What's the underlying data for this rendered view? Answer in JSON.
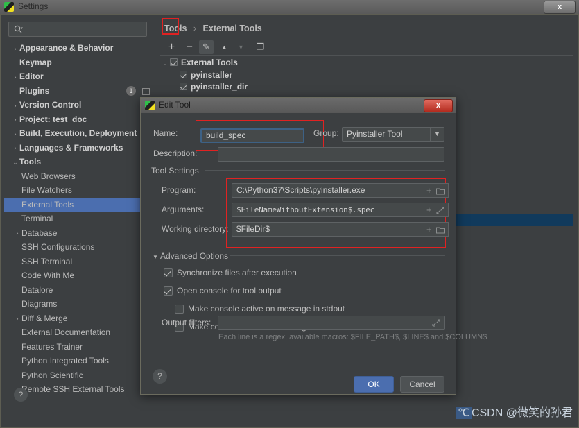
{
  "window": {
    "title": "Settings",
    "close_label": "x",
    "icon": "pycharm-icon"
  },
  "sidebar": {
    "search": {
      "value": "",
      "placeholder": ""
    },
    "items": [
      {
        "label": "Appearance & Behavior",
        "level": 0,
        "arrow": "›",
        "selected": false,
        "badge": "",
        "mini": ""
      },
      {
        "label": "Keymap",
        "level": 0,
        "arrow": "",
        "selected": false,
        "badge": "",
        "mini": ""
      },
      {
        "label": "Editor",
        "level": 0,
        "arrow": "›",
        "selected": false,
        "badge": "",
        "mini": ""
      },
      {
        "label": "Plugins",
        "level": 0,
        "arrow": "",
        "selected": false,
        "badge": "1",
        "mini": "outline"
      },
      {
        "label": "Version Control",
        "level": 0,
        "arrow": "›",
        "selected": false,
        "badge": "",
        "mini": "outline"
      },
      {
        "label": "Project: test_doc",
        "level": 0,
        "arrow": "›",
        "selected": false,
        "badge": "",
        "mini": "outline"
      },
      {
        "label": "Build, Execution, Deployment",
        "level": 0,
        "arrow": "›",
        "selected": false,
        "badge": "",
        "mini": ""
      },
      {
        "label": "Languages & Frameworks",
        "level": 0,
        "arrow": "›",
        "selected": false,
        "badge": "",
        "mini": ""
      },
      {
        "label": "Tools",
        "level": 0,
        "arrow": "⌄",
        "selected": false,
        "badge": "",
        "mini": ""
      },
      {
        "label": "Web Browsers",
        "level": 1,
        "arrow": "",
        "selected": false,
        "badge": "",
        "mini": ""
      },
      {
        "label": "File Watchers",
        "level": 1,
        "arrow": "",
        "selected": false,
        "badge": "",
        "mini": "outline"
      },
      {
        "label": "External Tools",
        "level": 1,
        "arrow": "",
        "selected": true,
        "badge": "",
        "mini": ""
      },
      {
        "label": "Terminal",
        "level": 1,
        "arrow": "",
        "selected": false,
        "badge": "",
        "mini": "outline"
      },
      {
        "label": "Database",
        "level": 1,
        "arrow": "›",
        "selected": false,
        "badge": "",
        "mini": ""
      },
      {
        "label": "SSH Configurations",
        "level": 1,
        "arrow": "",
        "selected": false,
        "badge": "",
        "mini": "outline"
      },
      {
        "label": "SSH Terminal",
        "level": 1,
        "arrow": "",
        "selected": false,
        "badge": "",
        "mini": "outline"
      },
      {
        "label": "Code With Me",
        "level": 1,
        "arrow": "",
        "selected": false,
        "badge": "",
        "mini": ""
      },
      {
        "label": "Datalore",
        "level": 1,
        "arrow": "",
        "selected": false,
        "badge": "",
        "mini": "outline"
      },
      {
        "label": "Diagrams",
        "level": 1,
        "arrow": "",
        "selected": false,
        "badge": "",
        "mini": ""
      },
      {
        "label": "Diff & Merge",
        "level": 1,
        "arrow": "›",
        "selected": false,
        "badge": "",
        "mini": ""
      },
      {
        "label": "External Documentation",
        "level": 1,
        "arrow": "",
        "selected": false,
        "badge": "",
        "mini": ""
      },
      {
        "label": "Features Trainer",
        "level": 1,
        "arrow": "",
        "selected": false,
        "badge": "",
        "mini": ""
      },
      {
        "label": "Python Integrated Tools",
        "level": 1,
        "arrow": "",
        "selected": false,
        "badge": "",
        "mini": "outline"
      },
      {
        "label": "Python Scientific",
        "level": 1,
        "arrow": "",
        "selected": false,
        "badge": "",
        "mini": "filled"
      },
      {
        "label": "Remote SSH External Tools",
        "level": 1,
        "arrow": "",
        "selected": false,
        "badge": "",
        "mini": ""
      }
    ],
    "help_label": "?"
  },
  "main": {
    "breadcrumb": {
      "root": "Tools",
      "separator": "›",
      "current": "External Tools"
    },
    "toolbar": {
      "add_label": "+",
      "remove_label": "−",
      "edit_label": "✎",
      "move_up_label": "▲",
      "move_down_label": "▼",
      "copy_label": "❐"
    },
    "tree": [
      {
        "label": "External Tools",
        "checked": true,
        "arrow": "⌄",
        "child": false
      },
      {
        "label": "pyinstaller",
        "checked": true,
        "arrow": "",
        "child": true
      },
      {
        "label": "pyinstaller_dir",
        "checked": true,
        "arrow": "",
        "child": true
      }
    ]
  },
  "dialog": {
    "title": "Edit Tool",
    "close_label": "x",
    "name": {
      "label": "Name:",
      "value": "build_spec"
    },
    "group": {
      "label": "Group:",
      "value": "Pyinstaller Tool",
      "caret": "▼"
    },
    "description": {
      "label": "Description:",
      "value": ""
    },
    "tool_settings": {
      "section_label": "Tool Settings",
      "program": {
        "label": "Program:",
        "value": "C:\\Python37\\Scripts\\pyinstaller.exe",
        "add_icon": "+",
        "browse_icon": "folder-icon"
      },
      "arguments": {
        "label": "Arguments:",
        "value": "$FileNameWithoutExtension$.spec",
        "add_icon": "+",
        "expand_icon": "expand-icon"
      },
      "working_directory": {
        "label": "Working directory:",
        "value": "$FileDir$",
        "add_icon": "+",
        "browse_icon": "folder-icon"
      }
    },
    "advanced": {
      "section_label": "Advanced Options",
      "caret": "▼",
      "checkboxes": [
        {
          "label": "Synchronize files after execution",
          "checked": true,
          "indent": 0
        },
        {
          "label": "Open console for tool output",
          "checked": true,
          "indent": 0
        },
        {
          "label": "Make console active on message in stdout",
          "checked": false,
          "indent": 1
        },
        {
          "label": "Make console active on message in stderr",
          "checked": false,
          "indent": 1
        }
      ],
      "output_filters": {
        "label": "Output filters:",
        "value": "",
        "expand_icon": "expand-icon"
      },
      "hint": "Each line is a regex, available macros: $FILE_PATH$, $LINE$ and $COLUMN$"
    },
    "help_label": "?",
    "ok_label": "OK",
    "cancel_label": "Cancel"
  },
  "watermark": {
    "prefix": "℃",
    "brand": "CSDN",
    "handle": "@微笑的孙君"
  },
  "colors": {
    "accent_blue": "#4b6eaf",
    "annotation_red": "#e02222",
    "panel_bg": "#3c3f41",
    "field_bg": "#45494a",
    "selection_band": "#113a5c"
  }
}
